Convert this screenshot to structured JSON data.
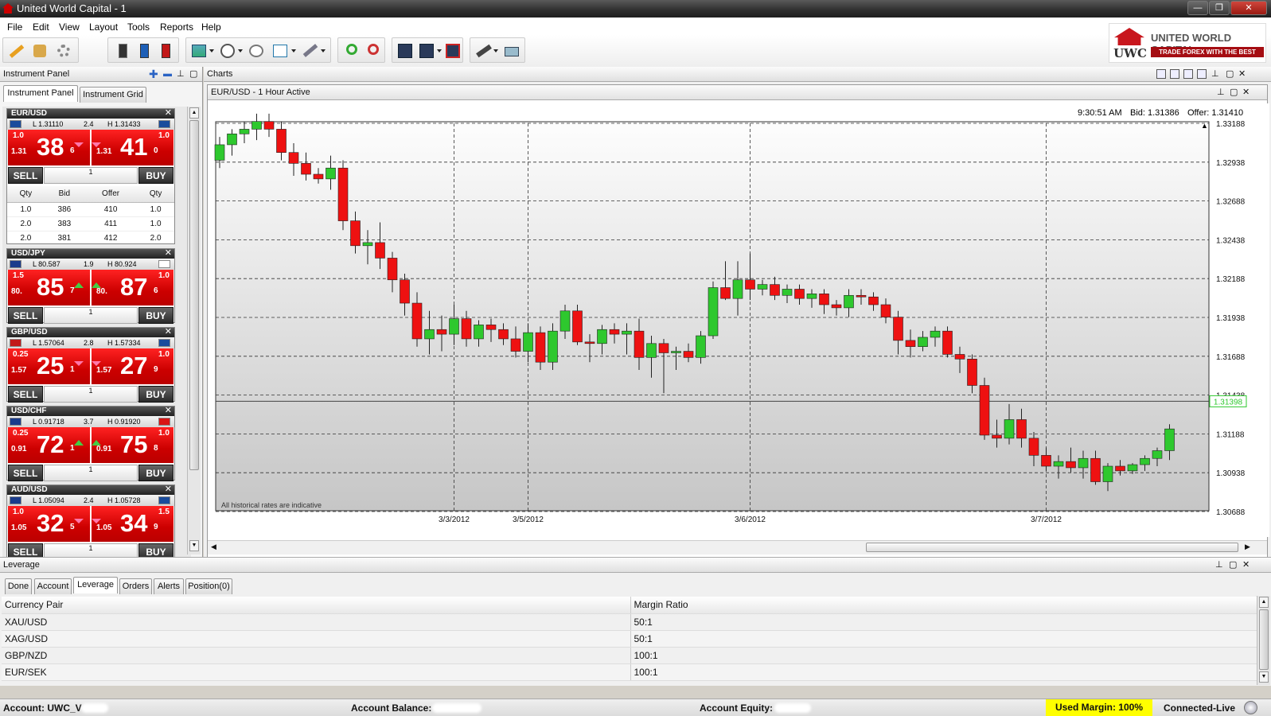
{
  "window": {
    "title": "United World Capital - 1",
    "min": "—",
    "max": "❐",
    "close": "✕"
  },
  "menu": [
    "File",
    "Edit",
    "View",
    "Layout",
    "Tools",
    "Reports",
    "Help"
  ],
  "logo": {
    "name": "UNITED WORLD CAPITAL",
    "abbr": "UWC",
    "slogan": "TRADE FOREX WITH THE BEST",
    "color": "#c8161d"
  },
  "instrument_panel": {
    "title": "Instrument Panel",
    "tabs": [
      "Instrument Panel",
      "Instrument Grid"
    ],
    "sell_label": "SELL",
    "buy_label": "BUY",
    "depth_headers": [
      "Qty",
      "Bid",
      "Offer",
      "Qty"
    ],
    "depth_rows": [
      [
        "1.0",
        "386",
        "410",
        "1.0"
      ],
      [
        "2.0",
        "383",
        "411",
        "1.0"
      ],
      [
        "2.0",
        "381",
        "412",
        "2.0"
      ]
    ],
    "instruments": [
      {
        "pair": "EUR/USD",
        "low": "L 1.31110",
        "spread": "2.4",
        "high": "H 1.31433",
        "bid_qty": "1.0",
        "bid_prefix": "1.31",
        "bid_big": "38",
        "bid_pip": "6",
        "bid_dir": "down",
        "ask_qty": "1.0",
        "ask_prefix": "1.31",
        "ask_big": "41",
        "ask_pip": "0",
        "ask_dir": "down",
        "amount": "1"
      },
      {
        "pair": "USD/JPY",
        "low": "L 80.587",
        "spread": "1.9",
        "high": "H 80.924",
        "bid_qty": "1.5",
        "bid_prefix": "80.",
        "bid_big": "85",
        "bid_pip": "7",
        "bid_dir": "up",
        "ask_qty": "1.0",
        "ask_prefix": "80.",
        "ask_big": "87",
        "ask_pip": "6",
        "ask_dir": "up",
        "amount": "1"
      },
      {
        "pair": "GBP/USD",
        "low": "L 1.57064",
        "spread": "2.8",
        "high": "H 1.57334",
        "bid_qty": "0.25",
        "bid_prefix": "1.57",
        "bid_big": "25",
        "bid_pip": "1",
        "bid_dir": "down",
        "ask_qty": "1.0",
        "ask_prefix": "1.57",
        "ask_big": "27",
        "ask_pip": "9",
        "ask_dir": "down",
        "amount": "1"
      },
      {
        "pair": "USD/CHF",
        "low": "L 0.91718",
        "spread": "3.7",
        "high": "H 0.91920",
        "bid_qty": "0.25",
        "bid_prefix": "0.91",
        "bid_big": "72",
        "bid_pip": "1",
        "bid_dir": "up",
        "ask_qty": "1.0",
        "ask_prefix": "0.91",
        "ask_big": "75",
        "ask_pip": "8",
        "ask_dir": "up",
        "amount": "1"
      },
      {
        "pair": "AUD/USD",
        "low": "L 1.05094",
        "spread": "2.4",
        "high": "H 1.05728",
        "bid_qty": "1.0",
        "bid_prefix": "1.05",
        "bid_big": "32",
        "bid_pip": "5",
        "bid_dir": "down",
        "ask_qty": "1.5",
        "ask_prefix": "1.05",
        "ask_big": "34",
        "ask_pip": "9",
        "ask_dir": "down",
        "amount": "1"
      }
    ]
  },
  "charts_panel": {
    "title": "Charts",
    "chart_title": "EUR/USD - 1 Hour Active",
    "time": "9:30:51 AM",
    "bid": "Bid: 1.31386",
    "offer": "Offer: 1.31410",
    "note": "All historical rates are indicative",
    "current_price_label": "1.31398"
  },
  "chart_data": {
    "type": "candlestick",
    "title": "EUR/USD - 1 Hour Active",
    "ylim": [
      1.30688,
      1.33188
    ],
    "yticks": [
      "1.33188",
      "1.32938",
      "1.32688",
      "1.32438",
      "1.32188",
      "1.31938",
      "1.31688",
      "1.31438",
      "1.31188",
      "1.30938",
      "1.30688"
    ],
    "xticks": [
      {
        "label": "3/3/2012",
        "index": 19
      },
      {
        "label": "3/5/2012",
        "index": 25
      },
      {
        "label": "3/6/2012",
        "index": 43
      },
      {
        "label": "3/7/2012",
        "index": 67
      }
    ],
    "current_price": 1.31398,
    "grid": true,
    "up_color": "#2ec82e",
    "down_color": "#ee1111",
    "candles": [
      [
        1.3295,
        1.331,
        1.329,
        1.3305
      ],
      [
        1.3305,
        1.3315,
        1.3298,
        1.3312
      ],
      [
        1.3312,
        1.332,
        1.3306,
        1.3315
      ],
      [
        1.3315,
        1.3325,
        1.3308,
        1.332
      ],
      [
        1.332,
        1.3325,
        1.331,
        1.3315
      ],
      [
        1.3315,
        1.332,
        1.3295,
        1.33
      ],
      [
        1.33,
        1.3306,
        1.3285,
        1.3293
      ],
      [
        1.3293,
        1.33,
        1.3282,
        1.3286
      ],
      [
        1.3286,
        1.329,
        1.328,
        1.3283
      ],
      [
        1.3283,
        1.3298,
        1.3276,
        1.329
      ],
      [
        1.329,
        1.3295,
        1.325,
        1.3256
      ],
      [
        1.3256,
        1.3262,
        1.3235,
        1.324
      ],
      [
        1.324,
        1.325,
        1.3228,
        1.3242
      ],
      [
        1.3242,
        1.3255,
        1.3225,
        1.3232
      ],
      [
        1.3232,
        1.3236,
        1.321,
        1.3218
      ],
      [
        1.3218,
        1.3222,
        1.3195,
        1.3203
      ],
      [
        1.3203,
        1.321,
        1.3175,
        1.318
      ],
      [
        1.318,
        1.3198,
        1.317,
        1.3186
      ],
      [
        1.3186,
        1.3195,
        1.3172,
        1.3183
      ],
      [
        1.3183,
        1.3202,
        1.3176,
        1.3193
      ],
      [
        1.3193,
        1.3198,
        1.3175,
        1.318
      ],
      [
        1.318,
        1.3192,
        1.3175,
        1.3189
      ],
      [
        1.3189,
        1.3193,
        1.3178,
        1.3186
      ],
      [
        1.3186,
        1.319,
        1.3176,
        1.318
      ],
      [
        1.318,
        1.3188,
        1.3168,
        1.3172
      ],
      [
        1.3172,
        1.319,
        1.3165,
        1.3184
      ],
      [
        1.3184,
        1.3188,
        1.316,
        1.3165
      ],
      [
        1.3165,
        1.319,
        1.316,
        1.3185
      ],
      [
        1.3185,
        1.3202,
        1.318,
        1.3198
      ],
      [
        1.3198,
        1.3202,
        1.3176,
        1.3178
      ],
      [
        1.3178,
        1.3183,
        1.3165,
        1.3177
      ],
      [
        1.3177,
        1.3189,
        1.317,
        1.3186
      ],
      [
        1.3186,
        1.319,
        1.3177,
        1.3183
      ],
      [
        1.3183,
        1.319,
        1.317,
        1.3185
      ],
      [
        1.3185,
        1.3193,
        1.316,
        1.3168
      ],
      [
        1.3168,
        1.3182,
        1.3155,
        1.3177
      ],
      [
        1.3177,
        1.318,
        1.3145,
        1.3171
      ],
      [
        1.3171,
        1.3175,
        1.316,
        1.3172
      ],
      [
        1.3172,
        1.3177,
        1.3165,
        1.3168
      ],
      [
        1.3168,
        1.3185,
        1.3164,
        1.3182
      ],
      [
        1.3182,
        1.3217,
        1.318,
        1.3213
      ],
      [
        1.3213,
        1.323,
        1.3205,
        1.3206
      ],
      [
        1.3206,
        1.323,
        1.3195,
        1.3218
      ],
      [
        1.3218,
        1.3235,
        1.3205,
        1.3212
      ],
      [
        1.3212,
        1.3218,
        1.3208,
        1.3215
      ],
      [
        1.3215,
        1.322,
        1.3205,
        1.3208
      ],
      [
        1.3208,
        1.3215,
        1.3203,
        1.3212
      ],
      [
        1.3212,
        1.3215,
        1.3202,
        1.3206
      ],
      [
        1.3206,
        1.3212,
        1.32,
        1.3209
      ],
      [
        1.3209,
        1.3212,
        1.3196,
        1.3202
      ],
      [
        1.3202,
        1.3205,
        1.3195,
        1.32
      ],
      [
        1.32,
        1.3212,
        1.3194,
        1.3208
      ],
      [
        1.3208,
        1.3212,
        1.3202,
        1.3207
      ],
      [
        1.3207,
        1.321,
        1.3198,
        1.3202
      ],
      [
        1.3202,
        1.3206,
        1.319,
        1.3194
      ],
      [
        1.3194,
        1.3198,
        1.317,
        1.3179
      ],
      [
        1.3179,
        1.3186,
        1.3168,
        1.3175
      ],
      [
        1.3175,
        1.3185,
        1.3172,
        1.3181
      ],
      [
        1.3181,
        1.3188,
        1.3175,
        1.3185
      ],
      [
        1.3185,
        1.3188,
        1.3168,
        1.317
      ],
      [
        1.317,
        1.3175,
        1.3158,
        1.3167
      ],
      [
        1.3167,
        1.317,
        1.3145,
        1.315
      ],
      [
        1.315,
        1.3155,
        1.3115,
        1.3118
      ],
      [
        1.3118,
        1.3128,
        1.311,
        1.3116
      ],
      [
        1.3116,
        1.3138,
        1.3112,
        1.3128
      ],
      [
        1.3128,
        1.3135,
        1.311,
        1.3116
      ],
      [
        1.3116,
        1.312,
        1.3098,
        1.3105
      ],
      [
        1.3105,
        1.311,
        1.3095,
        1.3098
      ],
      [
        1.3098,
        1.3105,
        1.309,
        1.3101
      ],
      [
        1.3101,
        1.311,
        1.3094,
        1.3097
      ],
      [
        1.3097,
        1.3108,
        1.309,
        1.3103
      ],
      [
        1.3103,
        1.3108,
        1.3086,
        1.3088
      ],
      [
        1.3088,
        1.31,
        1.3082,
        1.3098
      ],
      [
        1.3098,
        1.3102,
        1.3092,
        1.3095
      ],
      [
        1.3095,
        1.31,
        1.3093,
        1.3099
      ],
      [
        1.3099,
        1.3105,
        1.3095,
        1.3103
      ],
      [
        1.3103,
        1.311,
        1.3098,
        1.3108
      ],
      [
        1.3108,
        1.3125,
        1.3102,
        1.3122
      ]
    ]
  },
  "bottom_panel": {
    "title": "Leverage",
    "tabs": [
      "Done",
      "Account",
      "Leverage",
      "Orders",
      "Alerts",
      "Position(0)"
    ],
    "headers": [
      "Currency Pair",
      "Margin Ratio"
    ],
    "rows": [
      [
        "XAU/USD",
        "50:1"
      ],
      [
        "XAG/USD",
        "50:1"
      ],
      [
        "GBP/NZD",
        "100:1"
      ],
      [
        "EUR/SEK",
        "100:1"
      ]
    ]
  },
  "status": {
    "account": "Account: UWC_V",
    "balance": "Account Balance:",
    "equity": "Account Equity:",
    "used_margin": "Used Margin: 100%",
    "connection": "Connected-Live",
    "highlight_color": "#ffff00"
  }
}
